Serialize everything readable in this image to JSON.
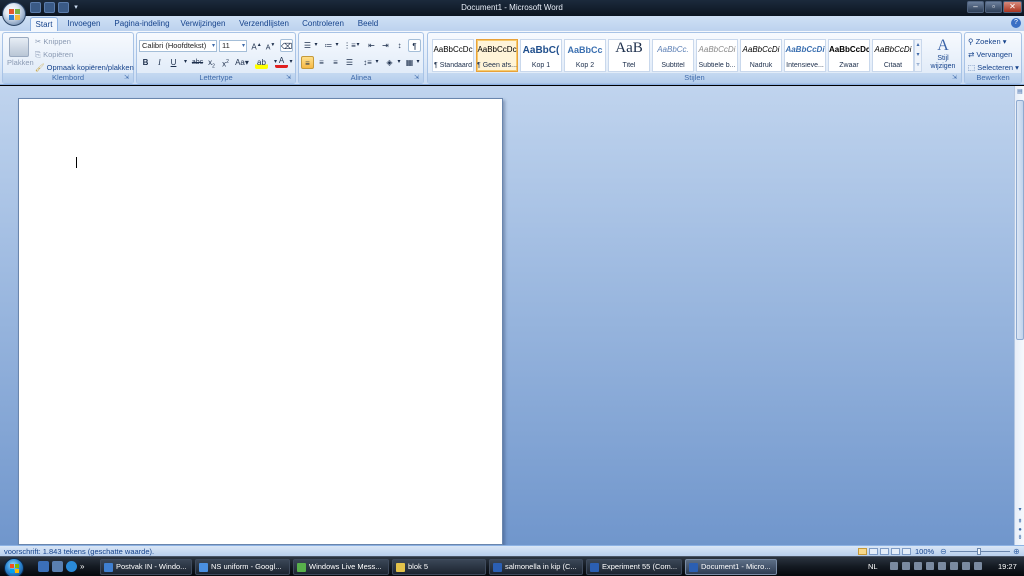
{
  "window": {
    "title": "Document1 - Microsoft Word"
  },
  "tabs": [
    "Start",
    "Invoegen",
    "Pagina-indeling",
    "Verwijzingen",
    "Verzendlijsten",
    "Controleren",
    "Beeld"
  ],
  "ribbon": {
    "clipboard": {
      "label": "Klembord",
      "paste": "Plakken",
      "cut": "Knippen",
      "copy": "Kopiëren",
      "format_painter": "Opmaak kopiëren/plakken"
    },
    "font": {
      "label": "Lettertype",
      "font_name": "Calibri (Hoofdtekst)",
      "font_size": "11"
    },
    "paragraph": {
      "label": "Alinea"
    },
    "styles": {
      "label": "Stijlen",
      "items": [
        {
          "sample": "AaBbCcDc",
          "name": "¶ Standaard"
        },
        {
          "sample": "AaBbCcDc",
          "name": "¶ Geen afs..."
        },
        {
          "sample": "AaBbC(",
          "name": "Kop 1"
        },
        {
          "sample": "AaBbCc",
          "name": "Kop 2"
        },
        {
          "sample": "AaB",
          "name": "Titel"
        },
        {
          "sample": "AaBbCc.",
          "name": "Subtitel"
        },
        {
          "sample": "AaBbCcDi",
          "name": "Subtiele b..."
        },
        {
          "sample": "AaBbCcDi",
          "name": "Nadruk"
        },
        {
          "sample": "AaBbCcDi",
          "name": "Intensieve..."
        },
        {
          "sample": "AaBbCcDc",
          "name": "Zwaar"
        },
        {
          "sample": "AaBbCcDi",
          "name": "Citaat"
        }
      ],
      "selected_index": 1,
      "change_styles_1": "Stijl",
      "change_styles_2": "wijzigen"
    },
    "editing": {
      "label": "Bewerken",
      "find": "Zoeken",
      "replace": "Vervangen",
      "select": "Selecteren"
    }
  },
  "statusbar": {
    "text": "voorschrift: 1.843 tekens (geschatte waarde).",
    "zoom": "100%"
  },
  "taskbar": {
    "tasks": [
      {
        "label": "Postvak IN - Windo...",
        "color": "#3f7fd0"
      },
      {
        "label": "NS uniform - Googl...",
        "color": "#4a90e2"
      },
      {
        "label": "Windows Live Mess...",
        "color": "#58b04b"
      },
      {
        "label": "blok 5",
        "color": "#e3c24a"
      },
      {
        "label": "salmonella in kip (C...",
        "color": "#2b5fb3"
      },
      {
        "label": "Experiment 55 (Com...",
        "color": "#2b5fb3"
      },
      {
        "label": "Document1 - Micro...",
        "color": "#2b5fb3"
      }
    ],
    "language": "NL",
    "clock": "19:27"
  }
}
